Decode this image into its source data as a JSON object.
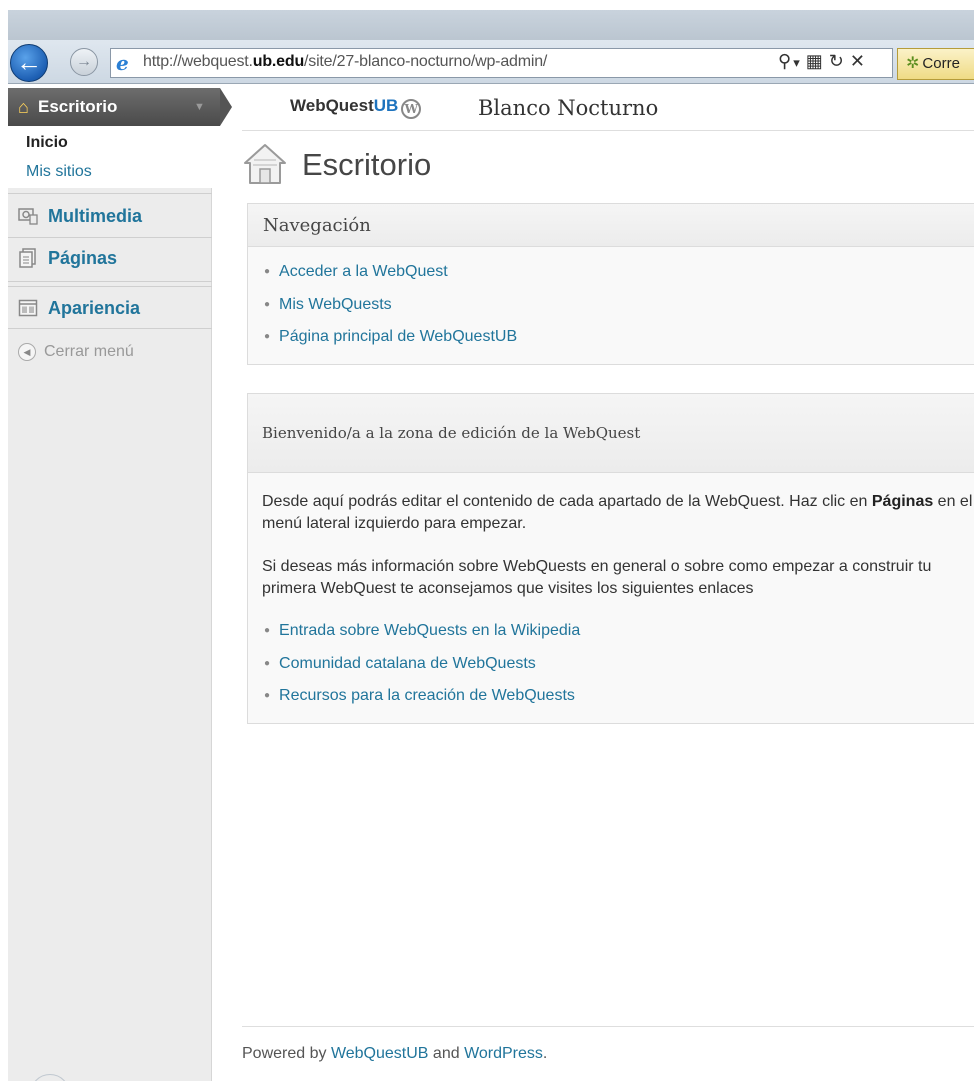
{
  "browser": {
    "back_glyph": "←",
    "forward_glyph": "→",
    "ie_logo": "e",
    "url_prefix": "http://web",
    "url_prefix2": "quest.",
    "url_domain": "ub.edu",
    "url_path": "/site/27-blanco-nocturno/wp-admin/",
    "search_glyph": "⚲",
    "dropdown_glyph": "▾",
    "compat_glyph": "▦",
    "refresh_glyph": "↻",
    "close_glyph": "✕",
    "tab_label": "Corre"
  },
  "sidebar": {
    "current": {
      "label": "Escritorio",
      "arrow": "▼"
    },
    "submenu": {
      "inicio": "Inicio",
      "mis_sitios": "Mis sitios"
    },
    "items": [
      {
        "label": "Multimedia",
        "icon": "media-icon"
      },
      {
        "label": "Páginas",
        "icon": "pages-icon"
      },
      {
        "label": "Apariencia",
        "icon": "appearance-icon"
      }
    ],
    "collapse": "Cerrar menú"
  },
  "header": {
    "brand_a": "WebQuest",
    "brand_b": "UB",
    "wp_logo": "W",
    "site_name": "Blanco Nocturno"
  },
  "page": {
    "title": "Escritorio"
  },
  "nav_box": {
    "title": "Navegación",
    "links": [
      "Acceder a la WebQuest",
      "Mis WebQuests",
      "Página principal de WebQuestUB"
    ]
  },
  "welcome_box": {
    "title": "Bienvenido/a a la zona de edición de la WebQuest",
    "para1_a": "Desde aquí podrás editar el contenido de cada apartado de la WebQuest. Haz clic en ",
    "para1_bold": "Páginas",
    "para1_b": " en el menú lateral izquierdo para empezar.",
    "para2": "Si deseas más información sobre WebQuests en general o sobre como empezar a construir tu primera WebQuest te aconsejamos que visites los siguientes enlaces",
    "links": [
      "Entrada sobre WebQuests en la Wikipedia",
      "Comunidad catalana de WebQuests",
      "Recursos para la creación de WebQuests"
    ]
  },
  "footer": {
    "prefix": "Powered by ",
    "link1": "WebQuestUB",
    "mid": " and ",
    "link2": "WordPress",
    "suffix": "."
  },
  "colors": {
    "link": "#21759b",
    "menu_current_bg": "#555555",
    "sidebar_bg": "#ececec"
  }
}
